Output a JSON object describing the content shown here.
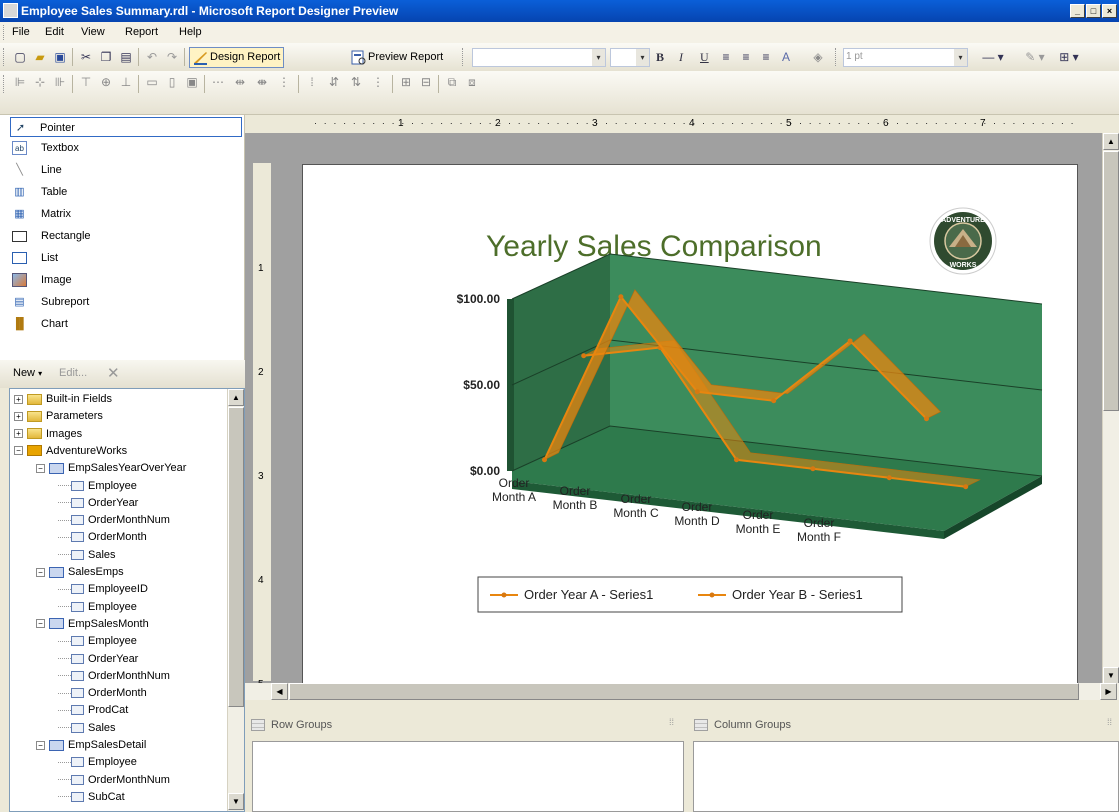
{
  "window": {
    "title": "Employee Sales Summary.rdl - Microsoft Report Designer Preview",
    "minimize": "_",
    "maximize": "□",
    "close": "×"
  },
  "menu": [
    "File",
    "Edit",
    "View",
    "Report",
    "Help"
  ],
  "toolbar": {
    "design_report": "Design Report",
    "preview_report": "Preview Report",
    "line_width": "1 pt",
    "bold": "B",
    "italic": "I",
    "underline": "U"
  },
  "toolbox": {
    "items": [
      {
        "label": "Pointer",
        "icon": "pointer-icon"
      },
      {
        "label": "Textbox",
        "icon": "textbox-icon"
      },
      {
        "label": "Line",
        "icon": "line-icon"
      },
      {
        "label": "Table",
        "icon": "table-icon"
      },
      {
        "label": "Matrix",
        "icon": "matrix-icon"
      },
      {
        "label": "Rectangle",
        "icon": "rectangle-icon"
      },
      {
        "label": "List",
        "icon": "list-icon"
      },
      {
        "label": "Image",
        "icon": "image-icon"
      },
      {
        "label": "Subreport",
        "icon": "subreport-icon"
      },
      {
        "label": "Chart",
        "icon": "chart-icon"
      }
    ]
  },
  "data_panel": {
    "new": "New",
    "edit": "Edit...",
    "tree": [
      {
        "label": "Built-in Fields",
        "kind": "folder",
        "level": 0,
        "expander": "+"
      },
      {
        "label": "Parameters",
        "kind": "folder",
        "level": 0,
        "expander": "+"
      },
      {
        "label": "Images",
        "kind": "folder",
        "level": 0,
        "expander": "+"
      },
      {
        "label": "AdventureWorks",
        "kind": "datasource",
        "level": 0,
        "expander": "−"
      },
      {
        "label": "EmpSalesYearOverYear",
        "kind": "dataset",
        "level": 1,
        "expander": "−"
      },
      {
        "label": "Employee",
        "kind": "field",
        "level": 2
      },
      {
        "label": "OrderYear",
        "kind": "field",
        "level": 2
      },
      {
        "label": "OrderMonthNum",
        "kind": "field",
        "level": 2
      },
      {
        "label": "OrderMonth",
        "kind": "field",
        "level": 2
      },
      {
        "label": "Sales",
        "kind": "field",
        "level": 2
      },
      {
        "label": "SalesEmps",
        "kind": "dataset",
        "level": 1,
        "expander": "−"
      },
      {
        "label": "EmployeeID",
        "kind": "field",
        "level": 2
      },
      {
        "label": "Employee",
        "kind": "field",
        "level": 2
      },
      {
        "label": "EmpSalesMonth",
        "kind": "dataset",
        "level": 1,
        "expander": "−"
      },
      {
        "label": "Employee",
        "kind": "field",
        "level": 2
      },
      {
        "label": "OrderYear",
        "kind": "field",
        "level": 2
      },
      {
        "label": "OrderMonthNum",
        "kind": "field",
        "level": 2
      },
      {
        "label": "OrderMonth",
        "kind": "field",
        "level": 2
      },
      {
        "label": "ProdCat",
        "kind": "field",
        "level": 2
      },
      {
        "label": "Sales",
        "kind": "field",
        "level": 2
      },
      {
        "label": "EmpSalesDetail",
        "kind": "dataset",
        "level": 1,
        "expander": "−"
      },
      {
        "label": "Employee",
        "kind": "field",
        "level": 2
      },
      {
        "label": "OrderMonthNum",
        "kind": "field",
        "level": 2
      },
      {
        "label": "SubCat",
        "kind": "field",
        "level": 2
      }
    ]
  },
  "ruler_marks": [
    "1",
    "2",
    "3",
    "4",
    "5",
    "6",
    "7"
  ],
  "vruler_marks": [
    "1",
    "2",
    "3",
    "4",
    "5"
  ],
  "report": {
    "title": "Yearly Sales Comparison",
    "logo_text": "ADVENTURE WORKS"
  },
  "groups": {
    "row": "Row Groups",
    "column": "Column Groups"
  },
  "chart_data": {
    "type": "line",
    "title": "Yearly Sales Comparison",
    "categories": [
      "Order Month A",
      "Order Month B",
      "Order Month C",
      "Order Month D",
      "Order Month E",
      "Order Month F"
    ],
    "series": [
      {
        "name": "Order Year A - Series1",
        "values": [
          50,
          60,
          0,
          0,
          0,
          0
        ]
      },
      {
        "name": "Order Year B - Series1",
        "values": [
          0,
          100,
          50,
          50,
          90,
          50
        ]
      }
    ],
    "ylim": [
      0,
      100
    ],
    "yticks": [
      "$0.00",
      "$50.00",
      "$100.00"
    ],
    "grid": true,
    "legend": "bottom",
    "colors": {
      "wall": "#3c8c5c",
      "floor": "#2e7a4c",
      "series": "#e8860f"
    }
  }
}
